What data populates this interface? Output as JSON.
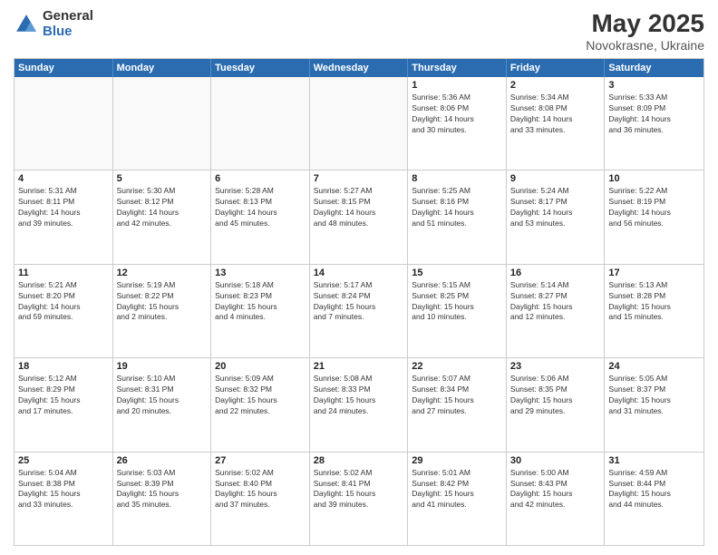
{
  "logo": {
    "general": "General",
    "blue": "Blue"
  },
  "title": {
    "month": "May 2025",
    "location": "Novokrasne, Ukraine"
  },
  "weekdays": [
    "Sunday",
    "Monday",
    "Tuesday",
    "Wednesday",
    "Thursday",
    "Friday",
    "Saturday"
  ],
  "rows": [
    [
      {
        "day": "",
        "info": "",
        "empty": true
      },
      {
        "day": "",
        "info": "",
        "empty": true
      },
      {
        "day": "",
        "info": "",
        "empty": true
      },
      {
        "day": "",
        "info": "",
        "empty": true
      },
      {
        "day": "1",
        "info": "Sunrise: 5:36 AM\nSunset: 8:06 PM\nDaylight: 14 hours\nand 30 minutes."
      },
      {
        "day": "2",
        "info": "Sunrise: 5:34 AM\nSunset: 8:08 PM\nDaylight: 14 hours\nand 33 minutes."
      },
      {
        "day": "3",
        "info": "Sunrise: 5:33 AM\nSunset: 8:09 PM\nDaylight: 14 hours\nand 36 minutes."
      }
    ],
    [
      {
        "day": "4",
        "info": "Sunrise: 5:31 AM\nSunset: 8:11 PM\nDaylight: 14 hours\nand 39 minutes."
      },
      {
        "day": "5",
        "info": "Sunrise: 5:30 AM\nSunset: 8:12 PM\nDaylight: 14 hours\nand 42 minutes."
      },
      {
        "day": "6",
        "info": "Sunrise: 5:28 AM\nSunset: 8:13 PM\nDaylight: 14 hours\nand 45 minutes."
      },
      {
        "day": "7",
        "info": "Sunrise: 5:27 AM\nSunset: 8:15 PM\nDaylight: 14 hours\nand 48 minutes."
      },
      {
        "day": "8",
        "info": "Sunrise: 5:25 AM\nSunset: 8:16 PM\nDaylight: 14 hours\nand 51 minutes."
      },
      {
        "day": "9",
        "info": "Sunrise: 5:24 AM\nSunset: 8:17 PM\nDaylight: 14 hours\nand 53 minutes."
      },
      {
        "day": "10",
        "info": "Sunrise: 5:22 AM\nSunset: 8:19 PM\nDaylight: 14 hours\nand 56 minutes."
      }
    ],
    [
      {
        "day": "11",
        "info": "Sunrise: 5:21 AM\nSunset: 8:20 PM\nDaylight: 14 hours\nand 59 minutes."
      },
      {
        "day": "12",
        "info": "Sunrise: 5:19 AM\nSunset: 8:22 PM\nDaylight: 15 hours\nand 2 minutes."
      },
      {
        "day": "13",
        "info": "Sunrise: 5:18 AM\nSunset: 8:23 PM\nDaylight: 15 hours\nand 4 minutes."
      },
      {
        "day": "14",
        "info": "Sunrise: 5:17 AM\nSunset: 8:24 PM\nDaylight: 15 hours\nand 7 minutes."
      },
      {
        "day": "15",
        "info": "Sunrise: 5:15 AM\nSunset: 8:25 PM\nDaylight: 15 hours\nand 10 minutes."
      },
      {
        "day": "16",
        "info": "Sunrise: 5:14 AM\nSunset: 8:27 PM\nDaylight: 15 hours\nand 12 minutes."
      },
      {
        "day": "17",
        "info": "Sunrise: 5:13 AM\nSunset: 8:28 PM\nDaylight: 15 hours\nand 15 minutes."
      }
    ],
    [
      {
        "day": "18",
        "info": "Sunrise: 5:12 AM\nSunset: 8:29 PM\nDaylight: 15 hours\nand 17 minutes."
      },
      {
        "day": "19",
        "info": "Sunrise: 5:10 AM\nSunset: 8:31 PM\nDaylight: 15 hours\nand 20 minutes."
      },
      {
        "day": "20",
        "info": "Sunrise: 5:09 AM\nSunset: 8:32 PM\nDaylight: 15 hours\nand 22 minutes."
      },
      {
        "day": "21",
        "info": "Sunrise: 5:08 AM\nSunset: 8:33 PM\nDaylight: 15 hours\nand 24 minutes."
      },
      {
        "day": "22",
        "info": "Sunrise: 5:07 AM\nSunset: 8:34 PM\nDaylight: 15 hours\nand 27 minutes."
      },
      {
        "day": "23",
        "info": "Sunrise: 5:06 AM\nSunset: 8:35 PM\nDaylight: 15 hours\nand 29 minutes."
      },
      {
        "day": "24",
        "info": "Sunrise: 5:05 AM\nSunset: 8:37 PM\nDaylight: 15 hours\nand 31 minutes."
      }
    ],
    [
      {
        "day": "25",
        "info": "Sunrise: 5:04 AM\nSunset: 8:38 PM\nDaylight: 15 hours\nand 33 minutes."
      },
      {
        "day": "26",
        "info": "Sunrise: 5:03 AM\nSunset: 8:39 PM\nDaylight: 15 hours\nand 35 minutes."
      },
      {
        "day": "27",
        "info": "Sunrise: 5:02 AM\nSunset: 8:40 PM\nDaylight: 15 hours\nand 37 minutes."
      },
      {
        "day": "28",
        "info": "Sunrise: 5:02 AM\nSunset: 8:41 PM\nDaylight: 15 hours\nand 39 minutes."
      },
      {
        "day": "29",
        "info": "Sunrise: 5:01 AM\nSunset: 8:42 PM\nDaylight: 15 hours\nand 41 minutes."
      },
      {
        "day": "30",
        "info": "Sunrise: 5:00 AM\nSunset: 8:43 PM\nDaylight: 15 hours\nand 42 minutes."
      },
      {
        "day": "31",
        "info": "Sunrise: 4:59 AM\nSunset: 8:44 PM\nDaylight: 15 hours\nand 44 minutes."
      }
    ]
  ]
}
